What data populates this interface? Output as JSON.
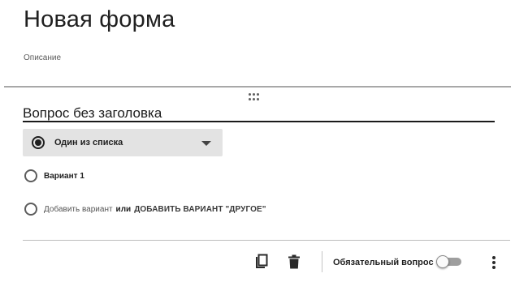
{
  "form": {
    "title": "Новая форма",
    "description": "Описание"
  },
  "question": {
    "title": "Вопрос без заголовка",
    "type_label": "Один из списка",
    "type_icon": "radio-checked-icon",
    "options": [
      {
        "label": "Вариант 1"
      }
    ],
    "add_option_label": "Добавить вариант",
    "or_label": "или",
    "add_other_label": "ДОБАВИТЬ ВАРИАНТ \"ДРУГОЕ\""
  },
  "footer": {
    "required_label": "Обязательный вопрос",
    "required_on": false,
    "icons": [
      "copy-icon",
      "trash-icon",
      "more-vert-icon"
    ]
  }
}
